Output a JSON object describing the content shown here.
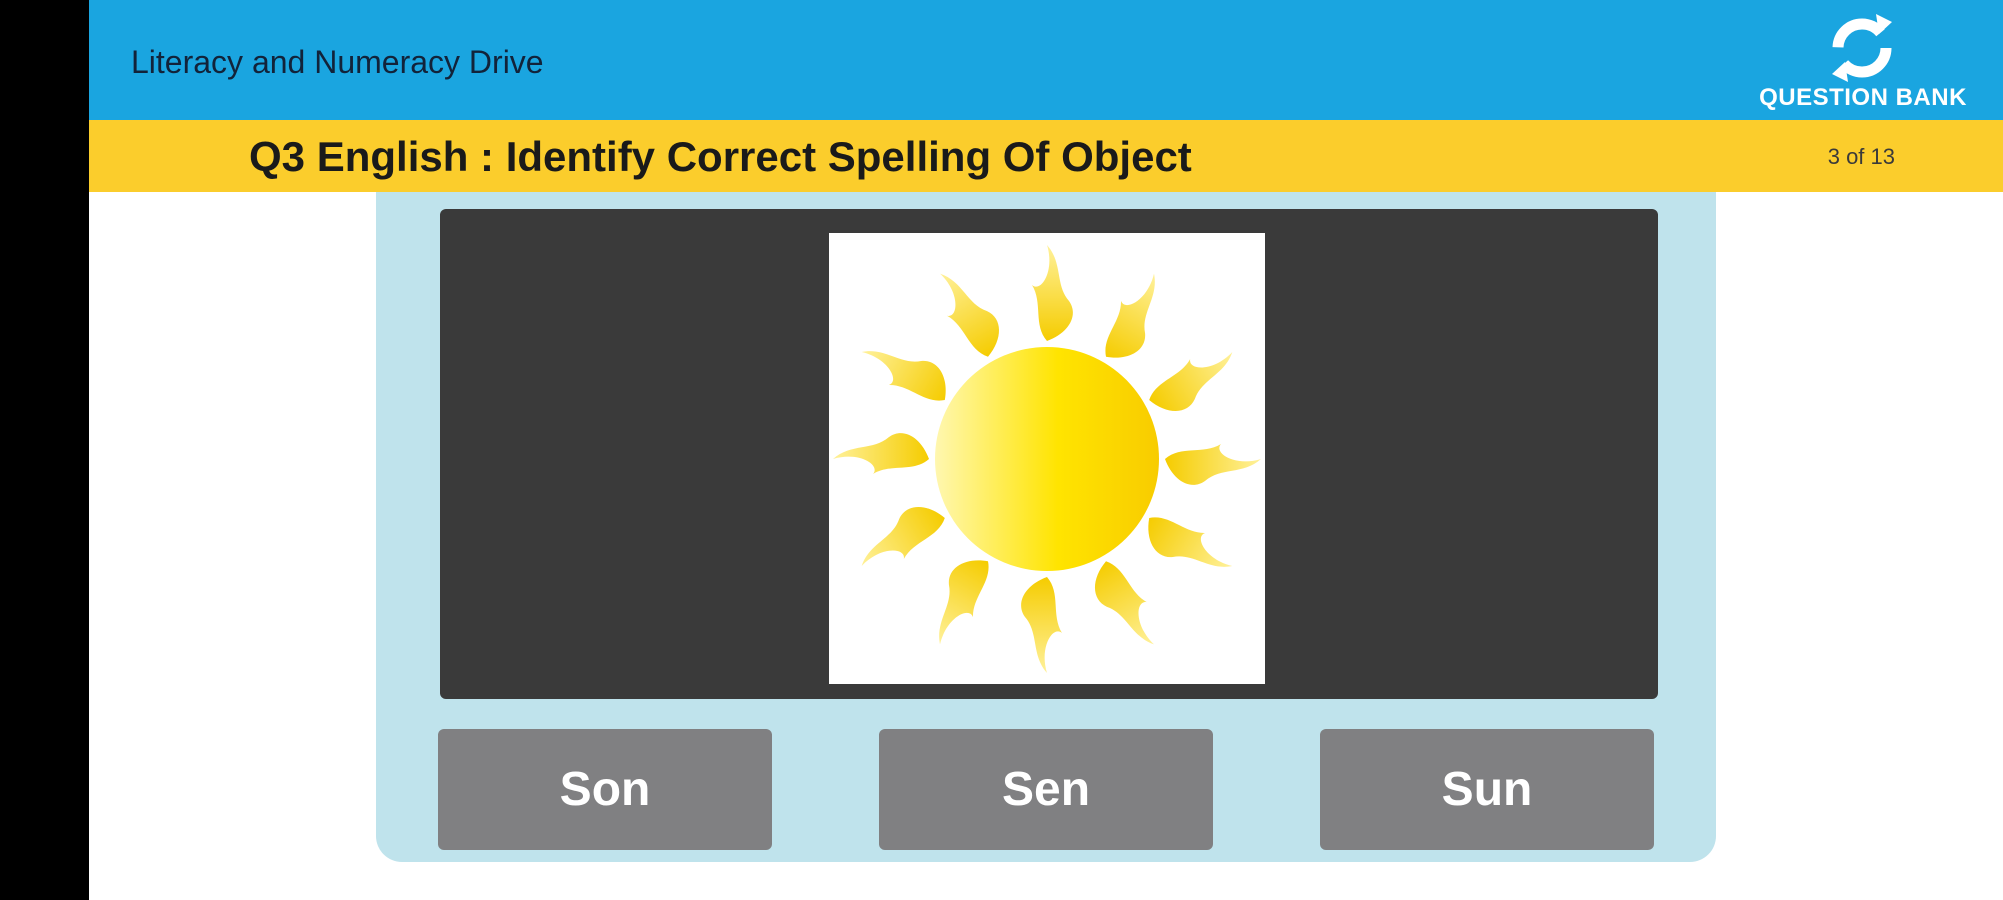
{
  "app": {
    "title": "Literacy and Numeracy Drive",
    "logo_text": "QUESTION BANK",
    "logo_icon": "refresh-cycle-icon"
  },
  "question": {
    "title": "Q3 English : Identify Correct Spelling Of Object",
    "progress": "3 of 13",
    "image_subject": "sun-image"
  },
  "answers": [
    {
      "label": "Son"
    },
    {
      "label": "Sen"
    },
    {
      "label": "Sun"
    }
  ],
  "colors": {
    "app_bar": "#1aa5e0",
    "question_bar": "#fbcd2c",
    "card": "#bfe3ec",
    "image_frame": "#3a3a3a",
    "answer_button": "#808082"
  }
}
